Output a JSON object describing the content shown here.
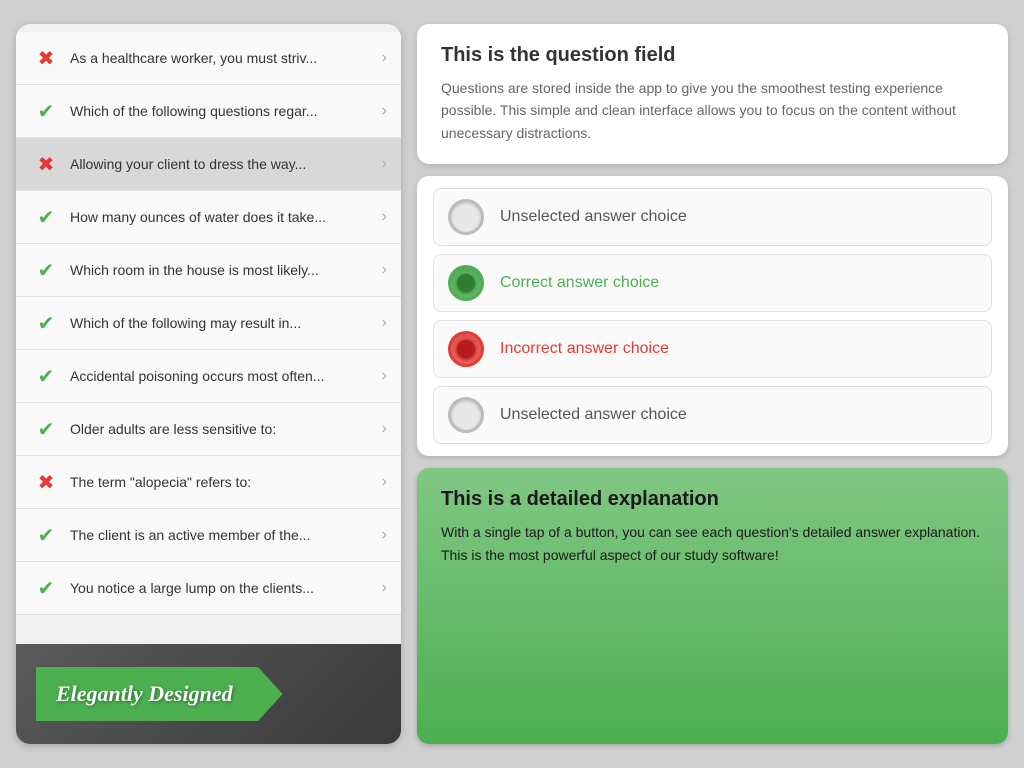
{
  "left": {
    "items": [
      {
        "id": 1,
        "status": "incorrect",
        "text": "As a healthcare worker, you must striv...",
        "selected": false
      },
      {
        "id": 2,
        "status": "correct",
        "text": "Which of the following questions regar...",
        "selected": false
      },
      {
        "id": 3,
        "status": "incorrect",
        "text": "Allowing your client to dress the way...",
        "selected": true
      },
      {
        "id": 4,
        "status": "correct",
        "text": "How many ounces of water does it take...",
        "selected": false
      },
      {
        "id": 5,
        "status": "correct",
        "text": "Which room in the house is most likely...",
        "selected": false
      },
      {
        "id": 6,
        "status": "correct",
        "text": "Which of the following may result in...",
        "selected": false
      },
      {
        "id": 7,
        "status": "correct",
        "text": "Accidental poisoning occurs most often...",
        "selected": false
      },
      {
        "id": 8,
        "status": "correct",
        "text": "Older adults are less sensitive to:",
        "selected": false
      },
      {
        "id": 9,
        "status": "incorrect",
        "text": "The term \"alopecia\" refers to:",
        "selected": false
      },
      {
        "id": 10,
        "status": "correct",
        "text": "The client is an active member of the...",
        "selected": false
      },
      {
        "id": 11,
        "status": "correct",
        "text": "You notice a large lump on the clients...",
        "selected": false
      }
    ],
    "banner": "Elegantly Designed"
  },
  "right": {
    "question_card": {
      "title": "This is the question field",
      "body": "Questions are stored inside the app to give you the smoothest testing experience possible. This simple and clean interface allows you to focus on the content without unecessary distractions."
    },
    "answers": [
      {
        "id": 1,
        "state": "unselected",
        "label": "Unselected answer choice"
      },
      {
        "id": 2,
        "state": "correct",
        "label": "Correct answer choice"
      },
      {
        "id": 3,
        "state": "incorrect",
        "label": "Incorrect answer choice"
      },
      {
        "id": 4,
        "state": "unselected",
        "label": "Unselected answer choice"
      }
    ],
    "explanation": {
      "title": "This is a detailed explanation",
      "body": "With a single tap of a button, you can see each question's detailed answer explanation. This is the most powerful aspect of our study software!"
    }
  }
}
